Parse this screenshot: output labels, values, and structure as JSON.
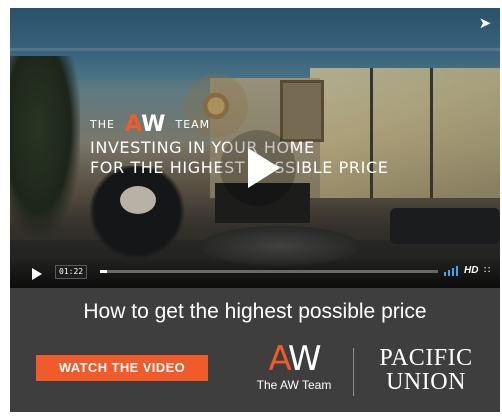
{
  "video": {
    "brand_the": "THE",
    "brand_aw_a": "A",
    "brand_aw_w": "W",
    "brand_team": "TEAM",
    "headline_line1": "INVESTING IN YOUR HOME",
    "headline_line2": "FOR THE HIGHEST POSSIBLE PRICE",
    "share_icon": "paper-plane-icon",
    "time": "01:22",
    "progress_fraction": 0.02,
    "hd_label": "HD",
    "fullscreen_icon": "fullscreen-icon"
  },
  "panel": {
    "tagline": "How to get the highest possible price",
    "cta_label": "WATCH THE VIDEO",
    "aw_logo_a": "A",
    "aw_logo_w": "W",
    "aw_logo_caption": "The AW Team",
    "pu_logo_line1": "PACIFIC",
    "pu_logo_line2": "UNION"
  },
  "colors": {
    "accent": "#f15a29",
    "panel_bg": "#3e3e3e",
    "volume": "#4aa3df"
  }
}
